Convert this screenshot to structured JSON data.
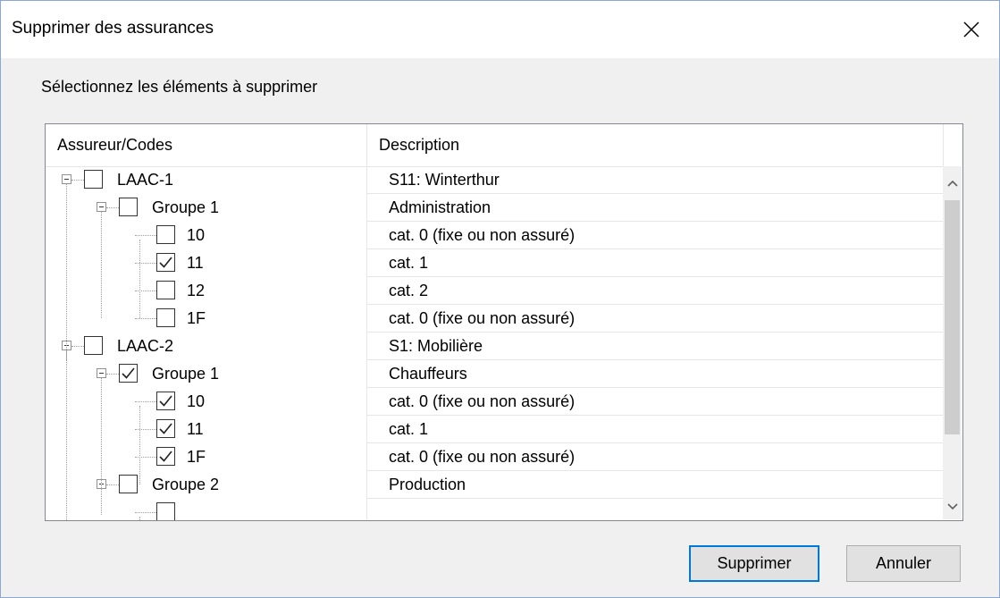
{
  "dialog": {
    "title": "Supprimer des assurances",
    "prompt": "Sélectionnez les éléments à supprimer"
  },
  "columns": {
    "col1": "Assureur/Codes",
    "col2": "Description"
  },
  "rows": [
    {
      "level": 0,
      "code": "LAAC-1",
      "description": "S11: Winterthur",
      "checked": false,
      "expandable": true
    },
    {
      "level": 1,
      "code": "Groupe 1",
      "description": "Administration",
      "checked": false,
      "expandable": true
    },
    {
      "level": 2,
      "code": "10",
      "description": "cat. 0 (fixe ou non assuré)",
      "checked": false,
      "expandable": false
    },
    {
      "level": 2,
      "code": "11",
      "description": "cat. 1",
      "checked": true,
      "expandable": false
    },
    {
      "level": 2,
      "code": "12",
      "description": "cat. 2",
      "checked": false,
      "expandable": false
    },
    {
      "level": 2,
      "code": "1F",
      "description": "cat. 0 (fixe ou non assuré)",
      "checked": false,
      "expandable": false
    },
    {
      "level": 0,
      "code": "LAAC-2",
      "description": "S1: Mobilière",
      "checked": false,
      "expandable": true
    },
    {
      "level": 1,
      "code": "Groupe 1",
      "description": "Chauffeurs",
      "checked": true,
      "expandable": true
    },
    {
      "level": 2,
      "code": "10",
      "description": "cat. 0 (fixe ou non assuré)",
      "checked": true,
      "expandable": false
    },
    {
      "level": 2,
      "code": "11",
      "description": "cat. 1",
      "checked": true,
      "expandable": false
    },
    {
      "level": 2,
      "code": "1F",
      "description": "cat. 0 (fixe ou non assuré)",
      "checked": true,
      "expandable": false
    },
    {
      "level": 1,
      "code": "Groupe 2",
      "description": "Production",
      "checked": false,
      "expandable": true
    },
    {
      "level": 2,
      "code": "",
      "description": "",
      "checked": false,
      "expandable": false
    }
  ],
  "buttons": {
    "delete": "Supprimer",
    "cancel": "Annuler"
  },
  "icons": {
    "close": "close-icon",
    "scroll_up": "chevron-up-icon",
    "scroll_down": "chevron-down-icon",
    "expand": "minus-box-icon",
    "check": "checkmark-icon"
  },
  "colors": {
    "accent": "#0078d7",
    "window_border": "#8aa8d0"
  }
}
